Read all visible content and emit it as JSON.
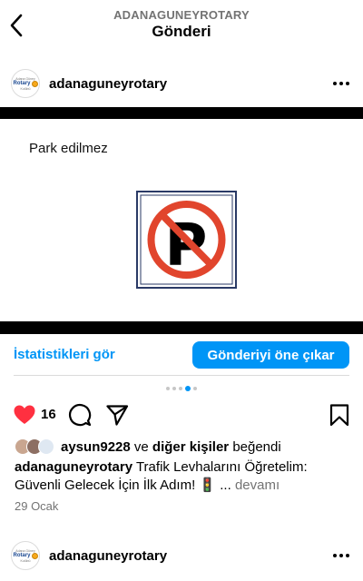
{
  "header": {
    "subtitle": "ADANAGUNEYROTARY",
    "title": "Gönderi"
  },
  "post": {
    "username": "adanaguneyrotary",
    "avatar_text": [
      "Adana Güney",
      "Rotary",
      "Kulübü"
    ],
    "media": {
      "caption": "Park edilmez",
      "sign": "no-parking-sign"
    },
    "stats_link": "İstatistikleri gör",
    "boost_button": "Gönderiyi öne çıkar",
    "carousel": {
      "count": 5,
      "active": 3
    },
    "like_count": "16",
    "liked_by": {
      "user": "aysun9228",
      "connector": "ve",
      "others": "diğer kişiler",
      "suffix": "beğendi"
    },
    "caption": {
      "username": "adanaguneyrotary",
      "text": "Trafik Levhalarını Öğretelim: Güvenli Gelecek İçin İlk Adım! 🚦 ...",
      "more": "devamı"
    },
    "date": "29 Ocak"
  },
  "next_post": {
    "username": "adanaguneyrotary"
  },
  "icons": {
    "back": "chevron-left-icon",
    "more": "more-horizontal-icon",
    "like": "heart-icon",
    "comment": "comment-icon",
    "share": "send-icon",
    "save": "bookmark-icon"
  },
  "colors": {
    "accent": "#0095f6",
    "like": "#ff3040",
    "muted": "#737373"
  }
}
